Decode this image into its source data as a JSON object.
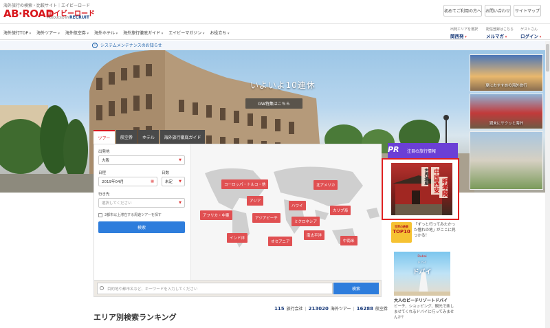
{
  "header": {
    "tagline": "海外旅行の検索・比較サイト｜エイビーロード",
    "logo": "AB·ROAD",
    "logo_kana": "エイビーロード",
    "produced_by": "PRODUCED BY",
    "recruit": "RECRUIT",
    "buttons": [
      "初めてご利用の方へ",
      "お問い合わせ",
      "サイトマップ"
    ]
  },
  "nav": {
    "items": [
      "海外旅行TOP",
      "海外ツアー",
      "海外航空券",
      "海外ホテル",
      "海外旅行徹底ガイド",
      "エイビーマガジン",
      "お役立ち"
    ],
    "departure_label": "出発エリアを選択",
    "departure_value": "関西発",
    "mail_label": "配信登録はこちら",
    "mail_value": "メルマガ",
    "guest_label": "ゲストさん",
    "guest_value": "ログイン"
  },
  "notice": {
    "icon": "!",
    "text": "システムメンテナンスのお知らせ"
  },
  "hero": {
    "title": "いよいよ10連休",
    "button": "GW特集はこちら",
    "thumbs": [
      {
        "caption": "夏におすすめの海外旅行"
      },
      {
        "caption": "週末にサクッと海外"
      }
    ]
  },
  "search": {
    "tabs": [
      "ツアー",
      "航空券",
      "ホテル",
      "海外旅行徹底ガイド"
    ],
    "departure_label": "出発地",
    "departure_value": "大阪",
    "date_label": "日程",
    "date_value": "2019年04月",
    "days_label": "日数",
    "days_value": "未定",
    "destination_label": "行き先",
    "destination_placeholder": "選択してください",
    "checkbox_label": "2都市以上滞在する周遊ツアーを探す",
    "search_button": "検索",
    "regions": [
      {
        "label": "ヨーロッパ・トルコ・他"
      },
      {
        "label": "北アメリカ"
      },
      {
        "label": "アジア"
      },
      {
        "label": "ハワイ"
      },
      {
        "label": "カリブ海"
      },
      {
        "label": "アフリカ・中東"
      },
      {
        "label": "アジアビーチ"
      },
      {
        "label": "ミクロネシア"
      },
      {
        "label": "インド洋"
      },
      {
        "label": "オセアニア"
      },
      {
        "label": "南太平洋"
      },
      {
        "label": "中南米"
      }
    ]
  },
  "keyword": {
    "placeholder": "目的地や都市名など、キーワードを入力してください",
    "button": "検索"
  },
  "stats": {
    "companies": "115",
    "companies_label": "旅行会社",
    "tours": "213020",
    "tours_label": "海外ツアー",
    "flights": "16288",
    "flights_label": "航空券"
  },
  "ranking_title": "エリア別検索ランキング",
  "pr": {
    "tag": "PR",
    "title": "注目の旅行情報",
    "image_text_1": "中国西安",
    "image_text_2": "世界遺産",
    "image_text_3": "明孝陵"
  },
  "ad2": {
    "badge_top": "世界の絶景",
    "badge_main": "TOP10",
    "text": "「ずっと行ってみたかった憧れの地」がここに見つかる！"
  },
  "ad3": {
    "line1": "Dubai",
    "line2": "ドバイ",
    "line3": "ドバイ",
    "title": "大人のビーチリゾートドバイ",
    "desc": "ビーチ、ショッピング、観光で楽しませてくれるドバイに行ってみませんか？"
  }
}
